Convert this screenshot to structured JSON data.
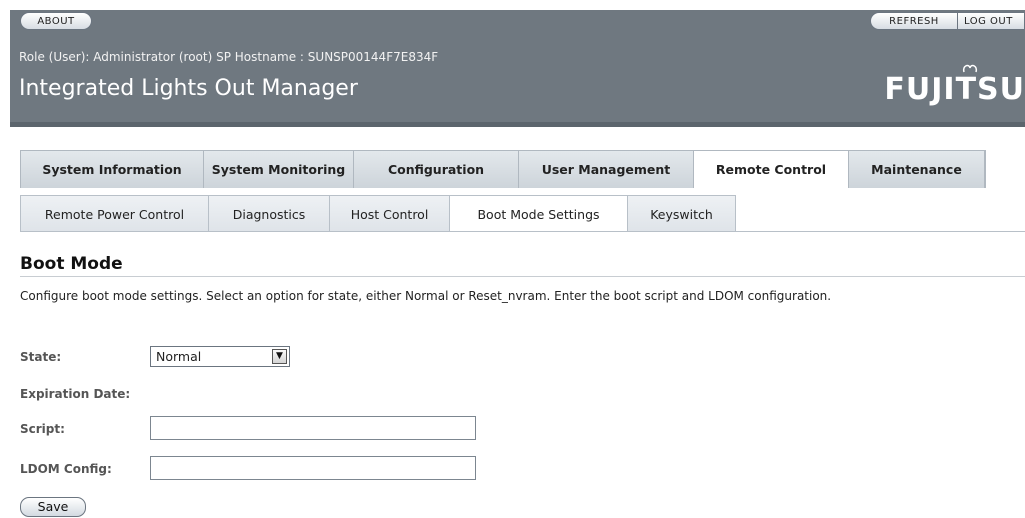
{
  "header": {
    "about_label": "ABOUT",
    "refresh_label": "REFRESH",
    "logout_label": "LOG OUT",
    "role_line": "Role (User): Administrator (root)   SP Hostname : SUNSP00144F7E834F",
    "app_title": "Integrated Lights Out Manager",
    "logo_text": "FUJITSU"
  },
  "main_tabs": [
    {
      "label": "System Information"
    },
    {
      "label": "System Monitoring"
    },
    {
      "label": "Configuration"
    },
    {
      "label": "User Management"
    },
    {
      "label": "Remote Control"
    },
    {
      "label": "Maintenance"
    }
  ],
  "sub_tabs": [
    {
      "label": "Remote Power Control"
    },
    {
      "label": "Diagnostics"
    },
    {
      "label": "Host Control"
    },
    {
      "label": "Boot Mode Settings"
    },
    {
      "label": "Keyswitch"
    }
  ],
  "page": {
    "title": "Boot Mode",
    "description": "Configure boot mode settings. Select an option for state, either Normal or Reset_nvram. Enter the boot script and LDOM configuration."
  },
  "form": {
    "state_label": "State:",
    "state_value": "Normal",
    "expiration_label": "Expiration Date:",
    "script_label": "Script:",
    "script_value": "",
    "ldom_label": "LDOM Config:",
    "ldom_value": "",
    "save_label": "Save"
  },
  "colors": {
    "header_bg": "#6f7880",
    "active_tab": "#ffffff"
  }
}
